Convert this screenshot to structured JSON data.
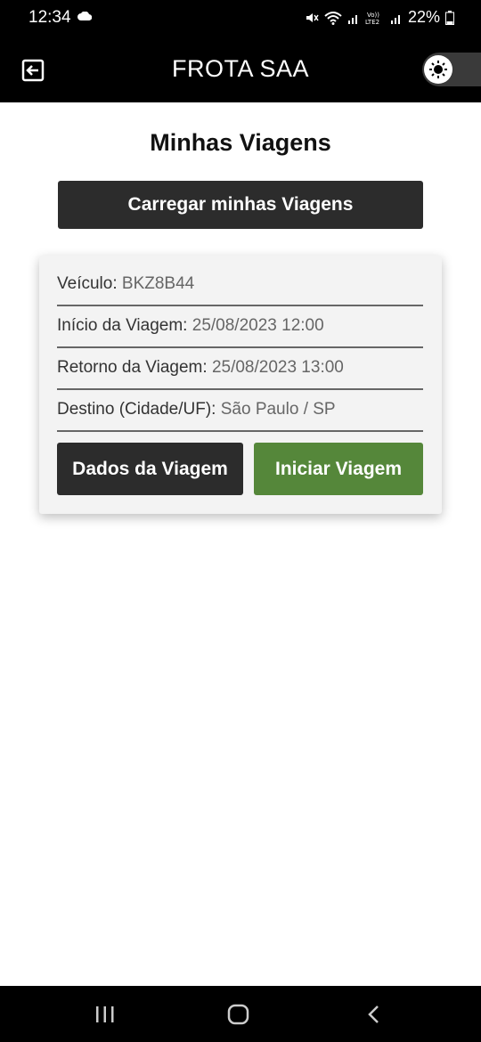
{
  "status_bar": {
    "time": "12:34",
    "battery": "22%",
    "icons": [
      "cloud-icon",
      "mute-icon",
      "wifi-icon",
      "signal-icon",
      "volte-icon",
      "signal-icon",
      "battery-icon"
    ]
  },
  "app_bar": {
    "title": "FROTA SAA",
    "exit_icon": "exit-icon",
    "theme_toggle_icon": "sun-icon"
  },
  "page": {
    "title": "Minhas Viagens",
    "load_button_label": "Carregar minhas Viagens"
  },
  "trip": {
    "vehicle_label": "Veículo:",
    "vehicle_value": "BKZ8B44",
    "start_label": "Início da Viagem:",
    "start_value": "25/08/2023 12:00",
    "return_label": "Retorno da Viagem:",
    "return_value": "25/08/2023 13:00",
    "destination_label": "Destino (Cidade/UF):",
    "destination_value": "São Paulo / SP",
    "details_button_label": "Dados da Viagem",
    "start_button_label": "Iniciar Viagem"
  },
  "colors": {
    "primary_dark": "#2c2c2c",
    "start_green": "#55873a",
    "card_bg": "#f3f3f3"
  },
  "nav_bar": {
    "icons": [
      "recent-apps-icon",
      "home-icon",
      "back-icon"
    ]
  }
}
